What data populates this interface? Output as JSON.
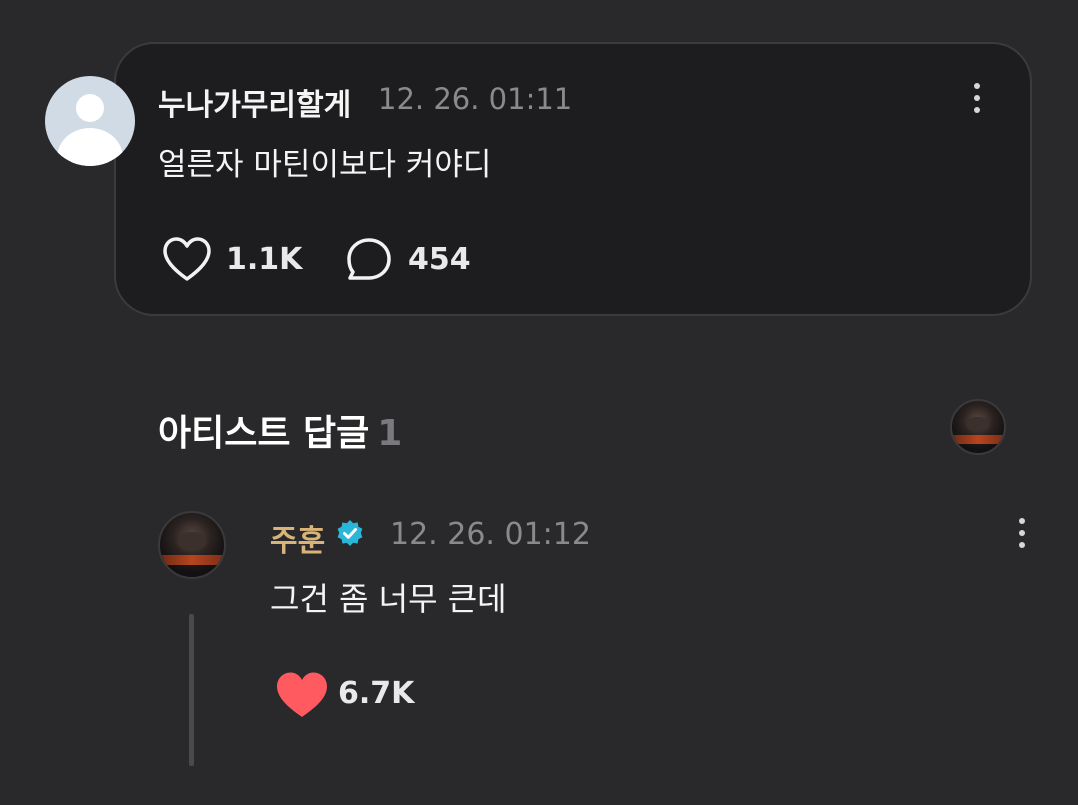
{
  "comment": {
    "username": "누나가무리할게",
    "timestamp": "12. 26. 01:11",
    "text": "얼른자 마틴이보다 커야디",
    "likes": "1.1K",
    "replies": "454"
  },
  "artist_replies": {
    "title": "아티스트 답글",
    "count": "1"
  },
  "reply": {
    "username": "주훈",
    "verified": true,
    "timestamp": "12. 26. 01:12",
    "text": "그건 좀 너무 큰데",
    "likes": "6.7K",
    "liked": true
  },
  "colors": {
    "background": "#29292b",
    "card": "#1d1d1f",
    "artist_name": "#d9b479",
    "verified_badge": "#29b6d8",
    "heart_active": "#ff5a5f"
  }
}
